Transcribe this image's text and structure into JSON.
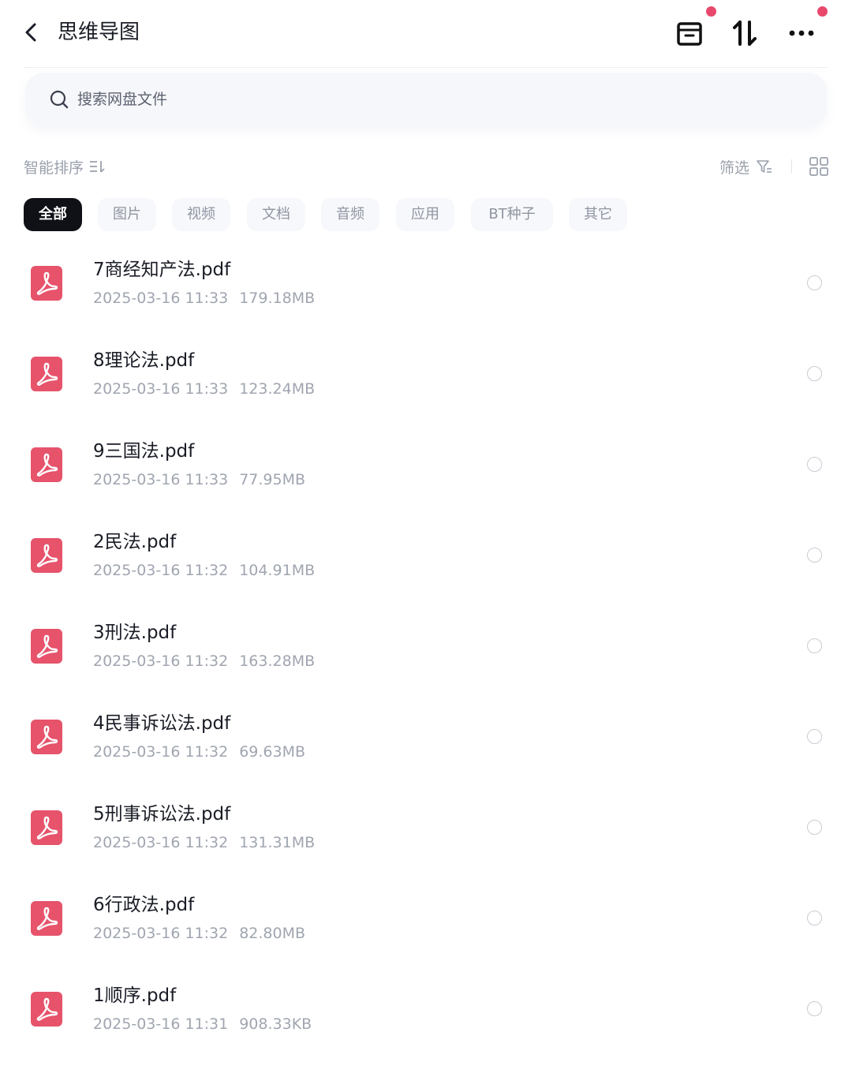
{
  "header": {
    "title": "思维导图",
    "icons": [
      "back-arrow-icon",
      "archive-box-icon",
      "sort-arrows-icon",
      "more-dots-icon"
    ],
    "badge_color": "#e8486c"
  },
  "search": {
    "placeholder": "搜索网盘文件"
  },
  "toolbar": {
    "sort_label": "智能排序",
    "filter_label": "筛选"
  },
  "tabs": [
    {
      "label": "全部",
      "active": true
    },
    {
      "label": "图片",
      "active": false
    },
    {
      "label": "视频",
      "active": false
    },
    {
      "label": "文档",
      "active": false
    },
    {
      "label": "音频",
      "active": false
    },
    {
      "label": "应用",
      "active": false
    },
    {
      "label": "BT种子",
      "active": false
    },
    {
      "label": "其它",
      "active": false
    }
  ],
  "files": [
    {
      "name": "7商经知产法.pdf",
      "date": "2025-03-16  11:33",
      "size": "179.18MB"
    },
    {
      "name": "8理论法.pdf",
      "date": "2025-03-16  11:33",
      "size": "123.24MB"
    },
    {
      "name": "9三国法.pdf",
      "date": "2025-03-16  11:33",
      "size": "77.95MB"
    },
    {
      "name": "2民法.pdf",
      "date": "2025-03-16  11:32",
      "size": "104.91MB"
    },
    {
      "name": "3刑法.pdf",
      "date": "2025-03-16  11:32",
      "size": "163.28MB"
    },
    {
      "name": "4民事诉讼法.pdf",
      "date": "2025-03-16  11:32",
      "size": "69.63MB"
    },
    {
      "name": "5刑事诉讼法.pdf",
      "date": "2025-03-16  11:32",
      "size": "131.31MB"
    },
    {
      "name": "6行政法.pdf",
      "date": "2025-03-16  11:32",
      "size": "82.80MB"
    },
    {
      "name": "1顺序.pdf",
      "date": "2025-03-16  11:31",
      "size": "908.33KB"
    }
  ],
  "colors": {
    "pdf_icon": "#e6536b",
    "active_tab": "#0f1117"
  }
}
